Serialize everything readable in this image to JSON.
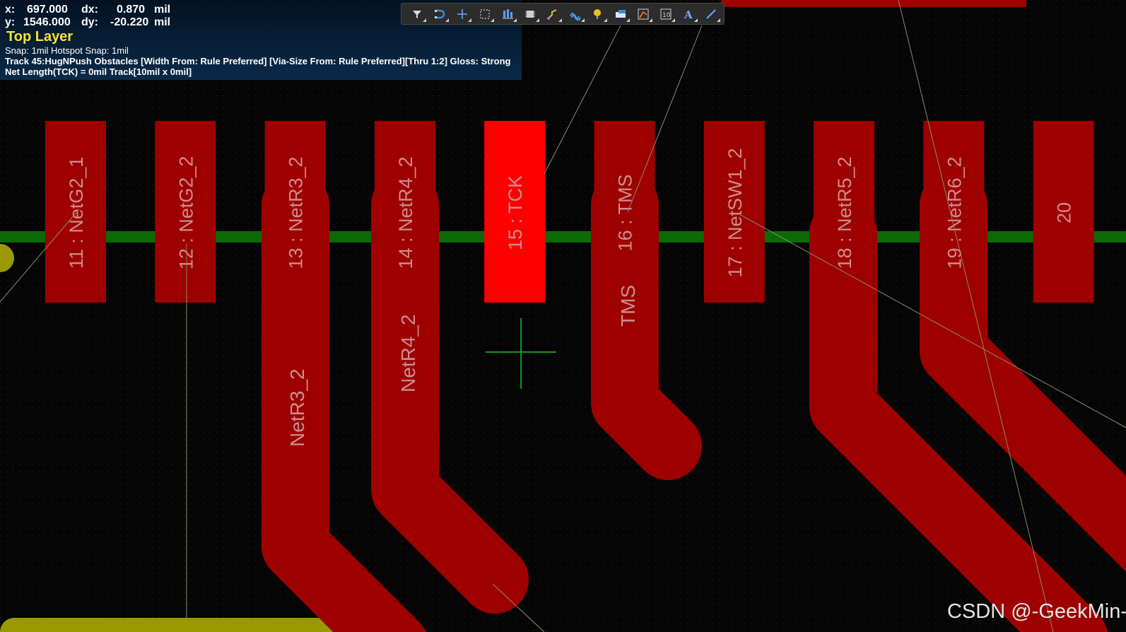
{
  "hud": {
    "x_label": "x:",
    "x_value": "697.000",
    "dx_label": "dx:",
    "dx_value": "0.870",
    "y_label": "y:",
    "y_value": "1546.000",
    "dy_label": "dy:",
    "dy_value": "-20.220",
    "unit": "mil",
    "layer": "Top Layer",
    "snap": "Snap: 1mil Hotspot Snap: 1mil",
    "track_mode": "Track 45:HugNPush Obstacles [Width From: Rule Preferred] [Via-Size From: Rule Preferred][Thru 1:2] Gloss: Strong",
    "net_length": "Net Length(TCK) = 0mil Track[10mil x 0mil]"
  },
  "toolbar": {
    "buttons": [
      {
        "name": "filter",
        "icon": "filter-icon"
      },
      {
        "name": "snap-options",
        "icon": "magnet-icon"
      },
      {
        "name": "place-component-origin",
        "icon": "crosshair-icon"
      },
      {
        "name": "select-region",
        "icon": "select-rect-icon"
      },
      {
        "name": "align",
        "icon": "align-icon"
      },
      {
        "name": "place-component",
        "icon": "component-icon"
      },
      {
        "name": "route-interactive",
        "icon": "route-icon"
      },
      {
        "name": "route-differential-pair",
        "icon": "diff-pair-icon"
      },
      {
        "name": "place-via",
        "icon": "via-icon"
      },
      {
        "name": "place-fill",
        "icon": "fill-icon"
      },
      {
        "name": "place-polygon",
        "icon": "polygon-icon"
      },
      {
        "name": "place-dimension",
        "icon": "dimension-icon"
      },
      {
        "name": "place-string",
        "icon": "text-icon"
      },
      {
        "name": "place-line",
        "icon": "line-icon"
      }
    ]
  },
  "pads": [
    {
      "label": "11 : NetG2_1",
      "selected": false
    },
    {
      "label": "12 : NetG2_2",
      "selected": false
    },
    {
      "label": "13 : NetR3_2",
      "selected": false
    },
    {
      "label": "14 : NetR4_2",
      "selected": false
    },
    {
      "label": "15 : TCK",
      "selected": true
    },
    {
      "label": "16 : TMS",
      "selected": false
    },
    {
      "label": "17 : NetSW1_2",
      "selected": false
    },
    {
      "label": "18 : NetR5_2",
      "selected": false
    },
    {
      "label": "19 : NetR6_2",
      "selected": false
    },
    {
      "label": "20",
      "selected": false
    }
  ],
  "track_labels": {
    "netr3": "NetR3_2",
    "netr4": "NetR4_2",
    "tms": "TMS"
  },
  "colors": {
    "top_layer": "#9e0000",
    "selected_pad": "#ff0000",
    "green_track": "#0d6a08",
    "yellow_layer": "#9a9a00",
    "cursor": "#1fbf1f",
    "ratsnest": "#8a8a6a"
  },
  "watermark": "CSDN @-GeekMin-"
}
